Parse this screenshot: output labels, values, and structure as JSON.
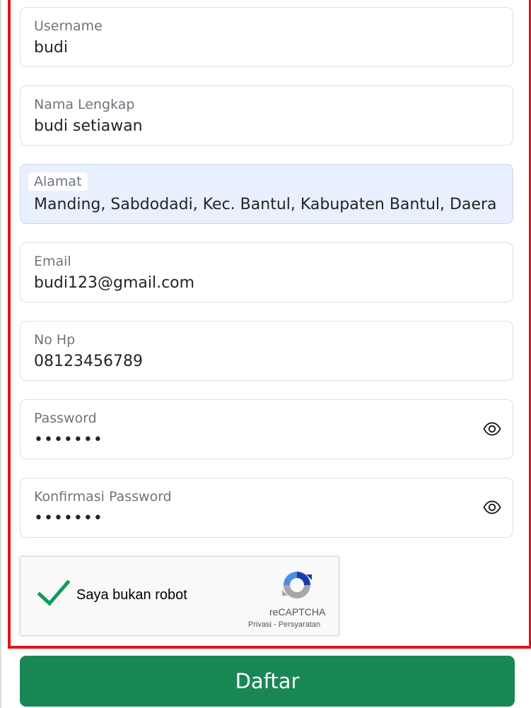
{
  "form": {
    "fields": [
      {
        "id": "username",
        "label": "Username",
        "value": "budi",
        "type": "text"
      },
      {
        "id": "nama",
        "label": "Nama Lengkap",
        "value": "budi setiawan",
        "type": "text"
      },
      {
        "id": "alamat",
        "label": "Alamat",
        "value": "Manding, Sabdodadi, Kec. Bantul, Kabupaten Bantul, Daera",
        "type": "text",
        "autofilled": true
      },
      {
        "id": "email",
        "label": "Email",
        "value": "budi123@gmail.com",
        "type": "email"
      },
      {
        "id": "nohp",
        "label": "No Hp",
        "value": "08123456789",
        "type": "text"
      },
      {
        "id": "password",
        "label": "Password",
        "value": "•••••••",
        "type": "password"
      },
      {
        "id": "konfirmasi",
        "label": "Konfirmasi Password",
        "value": "•••••••",
        "type": "password"
      }
    ],
    "submit_label": "Daftar"
  },
  "captcha": {
    "label": "Saya bukan robot",
    "checked": true,
    "brand": "reCAPTCHA",
    "privacy_link": "Privasi",
    "separator": "-",
    "terms_link": "Persyaratan"
  },
  "colors": {
    "highlight": "#e3131b",
    "primary_button": "#198754",
    "autofill_bg": "#e8f0fe",
    "check": "#109d59"
  },
  "icons": {
    "password_toggle": "eye-icon",
    "captcha_check": "checkmark-icon",
    "captcha_logo": "recaptcha-logo-icon"
  }
}
